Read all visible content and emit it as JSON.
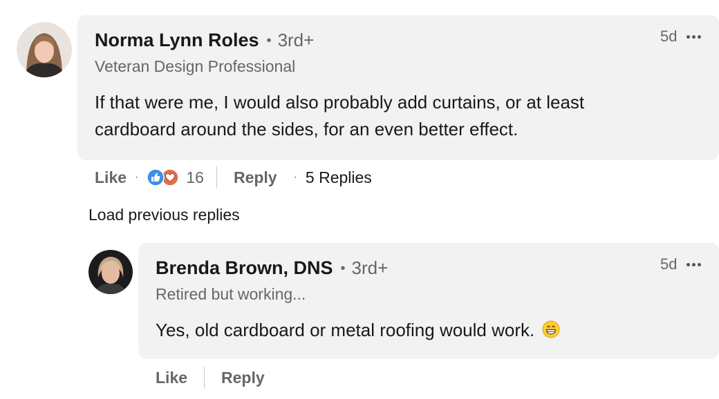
{
  "colors": {
    "bubble_bg": "#f2f2f2",
    "secondary_text": "#666666",
    "like_blue": "#378fe9",
    "love_red": "#df704d"
  },
  "comment": {
    "author_name": "Norma Lynn Roles",
    "degree": "3rd+",
    "headline": "Veteran Design Professional",
    "time": "5d",
    "more_icon": "ellipsis-icon",
    "text": "If that were me, I would also probably add curtains, or at least cardboard around the sides, for an even better effect.",
    "actions": {
      "like_label": "Like",
      "reaction_icons": [
        "like-reaction-icon",
        "love-reaction-icon"
      ],
      "reaction_count": "16",
      "reply_label": "Reply",
      "replies_label": "5 Replies"
    }
  },
  "load_previous_label": "Load previous replies",
  "reply": {
    "author_name": "Brenda Brown, DNS",
    "degree": "3rd+",
    "headline": "Retired but working...",
    "time": "5d",
    "more_icon": "ellipsis-icon",
    "text": "Yes, old cardboard or metal roofing would work.",
    "emoji_icon": "grinning-face-emoji",
    "actions": {
      "like_label": "Like",
      "reply_label": "Reply"
    }
  }
}
